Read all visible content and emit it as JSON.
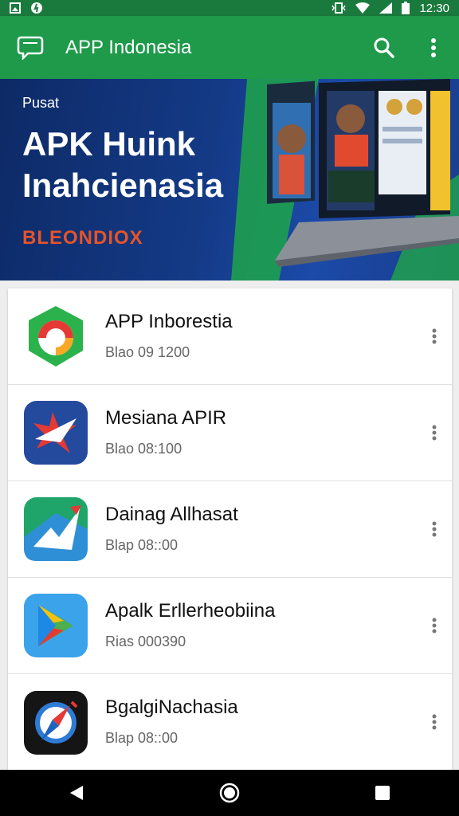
{
  "status_bar": {
    "time": "12:30",
    "icons": [
      "image-icon",
      "app-notification-icon",
      "vibrate-icon",
      "wifi-icon",
      "signal-icon",
      "battery-icon"
    ]
  },
  "app_bar": {
    "title": "APP Indonesia",
    "logo_icon": "chat-icon",
    "actions": [
      "search-icon",
      "more-vert-icon"
    ],
    "color": "#1e9a4a"
  },
  "banner": {
    "eyebrow": "Pusat",
    "headline": "APK Huink Inahcienasia",
    "brand": "BLEONDIOX"
  },
  "apps": [
    {
      "title": "APP Inborestia",
      "subtitle": "Blao 09 1200",
      "icon": "chrome-style-app-icon"
    },
    {
      "title": "Mesiana APIR",
      "subtitle": "Blao 08:100",
      "icon": "star-arrow-app-icon"
    },
    {
      "title": "Dainag Allhasat",
      "subtitle": "Blap 08::00",
      "icon": "maps-style-app-icon"
    },
    {
      "title": "Apalk Erllerheobiina",
      "subtitle": "Rias 000390",
      "icon": "play-store-style-app-icon"
    },
    {
      "title": "BgalgiNachasia",
      "subtitle": "Blap 08::00",
      "icon": "compass-style-app-icon"
    }
  ],
  "nav_bar": {
    "buttons": [
      "back-icon",
      "home-icon",
      "recents-icon"
    ]
  }
}
